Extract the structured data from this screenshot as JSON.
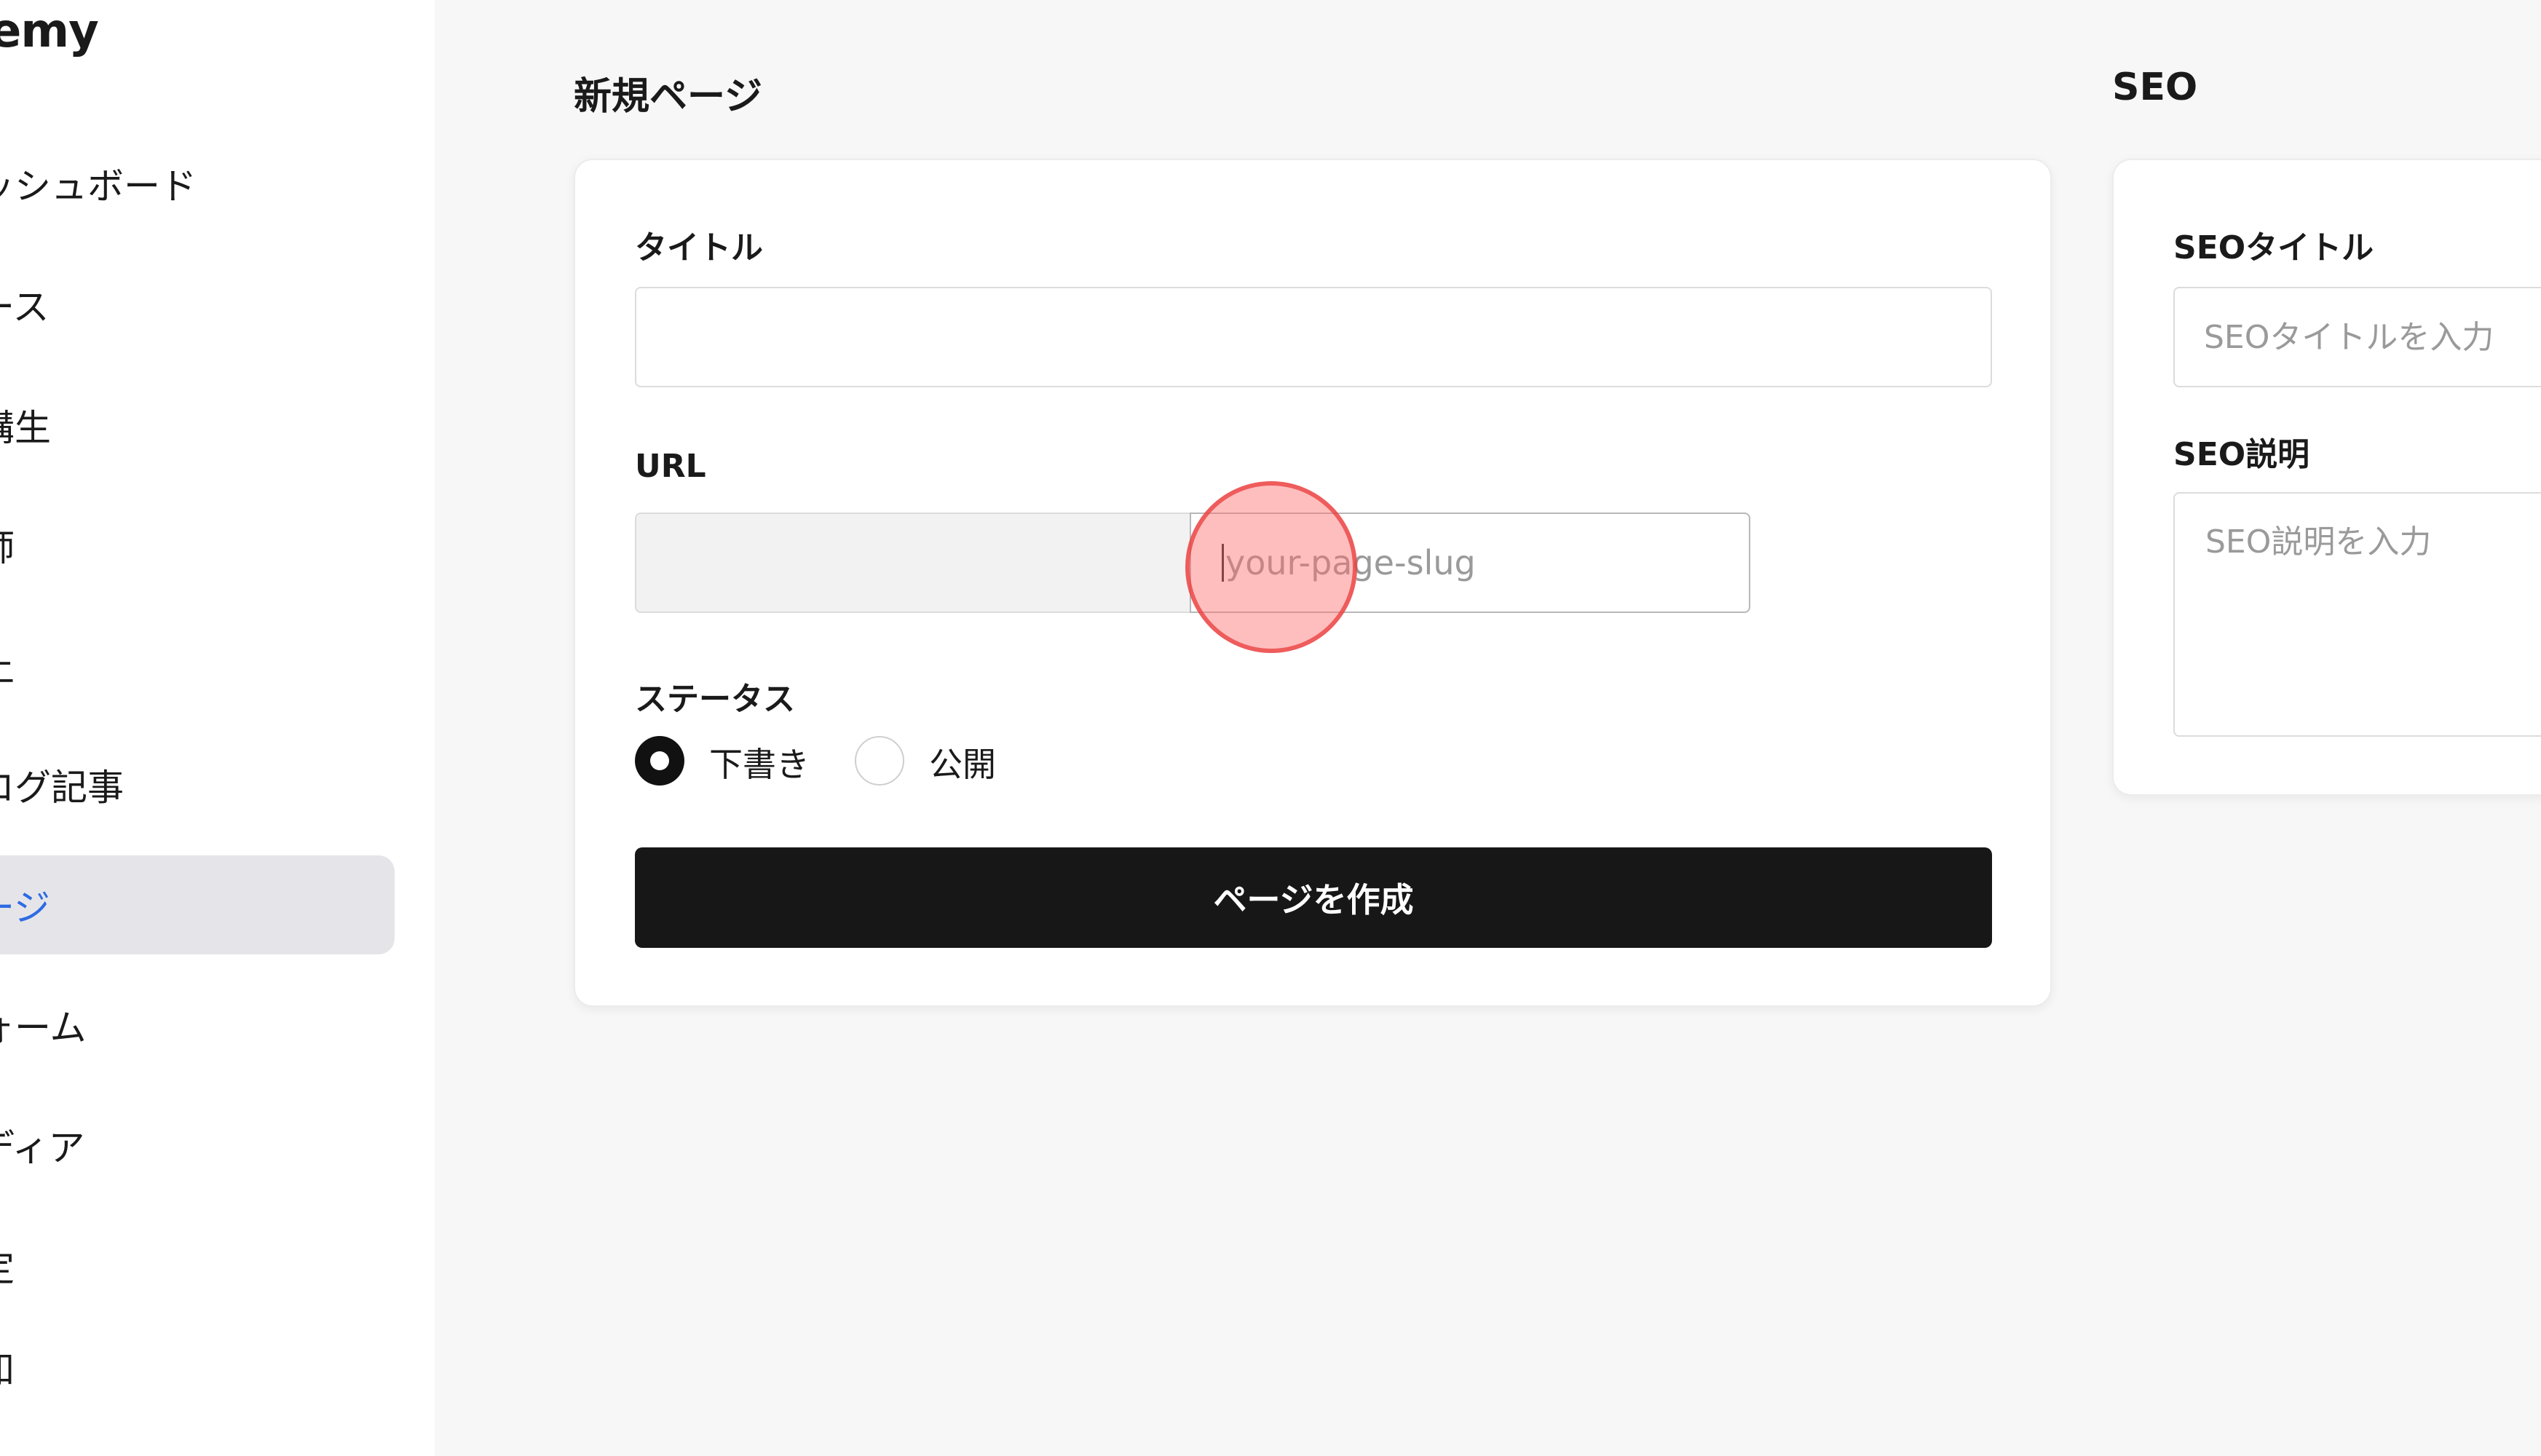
{
  "sidebar": {
    "brand": "emy",
    "items": [
      {
        "label": "ッシュボード",
        "active": false
      },
      {
        "label": "ース",
        "active": false
      },
      {
        "label": "講生",
        "active": false
      },
      {
        "label": "師",
        "active": false
      },
      {
        "label": "上",
        "active": false
      },
      {
        "label": "ログ記事",
        "active": false
      },
      {
        "label": "ージ",
        "active": true
      },
      {
        "label": "ォーム",
        "active": false
      },
      {
        "label": "ディア",
        "active": false
      },
      {
        "label": "定",
        "active": false
      },
      {
        "label": "知",
        "active": false
      }
    ]
  },
  "new_page": {
    "heading": "新規ページ",
    "title_label": "タイトル",
    "title_value": "",
    "url_label": "URL",
    "url_prefix": "",
    "slug_placeholder": "your-page-slug",
    "status_label": "ステータス",
    "status_options": [
      {
        "label": "下書き",
        "selected": true
      },
      {
        "label": "公開",
        "selected": false
      }
    ],
    "create_button": "ページを作成"
  },
  "seo": {
    "heading": "SEO",
    "title_label": "SEOタイトル",
    "title_placeholder": "SEOタイトルを入力",
    "description_label": "SEO説明",
    "description_placeholder": "SEO説明を入力"
  },
  "colors": {
    "accent": "#2f6be3",
    "primary_button": "#171717",
    "click_indicator": "#e83c3c"
  }
}
